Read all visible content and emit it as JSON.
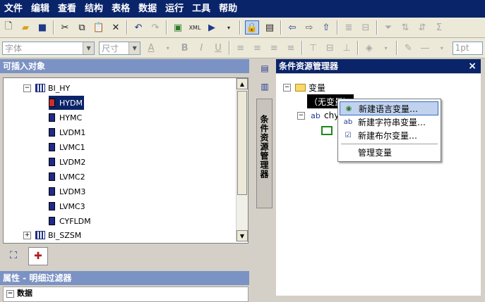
{
  "menu": [
    "文件",
    "编辑",
    "查看",
    "结构",
    "表格",
    "数据",
    "运行",
    "工具",
    "帮助"
  ],
  "toolbar2": {
    "font_placeholder": "字体",
    "size_placeholder": "尺寸",
    "line_width": "1pt"
  },
  "left_panel": {
    "title": "可插入对象",
    "tree": {
      "parent": "BI_HY",
      "children": [
        "HYDM",
        "HYMC",
        "LVDM1",
        "LVMC1",
        "LVDM2",
        "LVMC2",
        "LVDM3",
        "LVMC3",
        "CYFLDM"
      ],
      "sibling": "BI_SZSM"
    }
  },
  "properties_panel": {
    "title": "属性 - 明细过滤器",
    "section": "数据",
    "section_expander": "−"
  },
  "side_tab": {
    "label": "条件资源管理器"
  },
  "right_panel": {
    "title": "条件资源管理器",
    "close": "×",
    "tree": {
      "root": "变量",
      "no_variable": "（无变量）",
      "variable": "chy"
    }
  },
  "context_menu": {
    "items": [
      "新建语言变量…",
      "新建字符串变量…",
      "新建布尔变量…"
    ],
    "manage": "管理变量"
  },
  "colors": {
    "menubar": "#0a246a",
    "panel_header": "#7b92c4",
    "highlight": "#c1d2ee"
  }
}
